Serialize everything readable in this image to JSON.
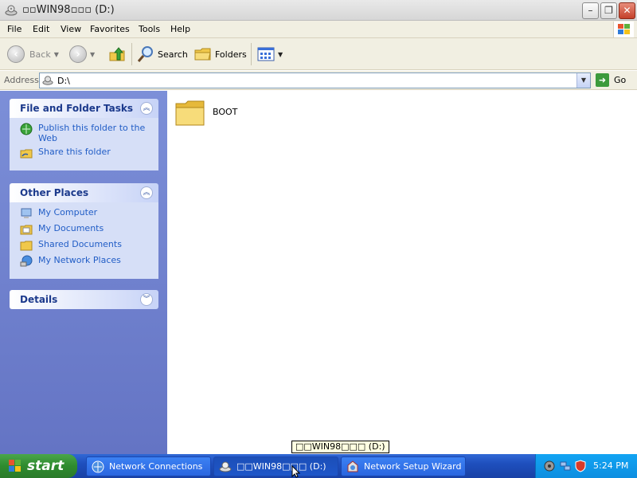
{
  "window": {
    "title": "▫▫WIN98▫▫▫ (D:)"
  },
  "menu": [
    "File",
    "Edit",
    "View",
    "Favorites",
    "Tools",
    "Help"
  ],
  "toolbar": {
    "back_label": "Back",
    "search_label": "Search",
    "folders_label": "Folders"
  },
  "address": {
    "label": "Address",
    "value": "D:\\",
    "go_label": "Go"
  },
  "tasks_panel": {
    "title": "File and Folder Tasks",
    "items": [
      {
        "label": "Publish this folder to the Web",
        "icon": "globe-publish-icon"
      },
      {
        "label": "Share this folder",
        "icon": "share-folder-icon"
      }
    ]
  },
  "places_panel": {
    "title": "Other Places",
    "items": [
      {
        "label": "My Computer",
        "icon": "computer-icon"
      },
      {
        "label": "My Documents",
        "icon": "documents-icon"
      },
      {
        "label": "Shared Documents",
        "icon": "shared-folder-icon"
      },
      {
        "label": "My Network Places",
        "icon": "network-icon"
      }
    ]
  },
  "details_panel": {
    "title": "Details"
  },
  "files": [
    {
      "name": "BOOT",
      "type": "folder"
    }
  ],
  "tooltip": "□□WIN98□□□ (D:)",
  "taskbar": {
    "start_label": "start",
    "tasks": [
      {
        "label": "Network Connections"
      },
      {
        "label": "□□WIN98□□□ (D:)"
      },
      {
        "label": "Network Setup Wizard"
      }
    ],
    "clock": "5:24 PM"
  },
  "colors": {
    "taskpane_bg": "#7c8fd8",
    "link_blue": "#215dc6",
    "taskbar_blue": "#245edb",
    "start_green": "#3a9a3a"
  }
}
